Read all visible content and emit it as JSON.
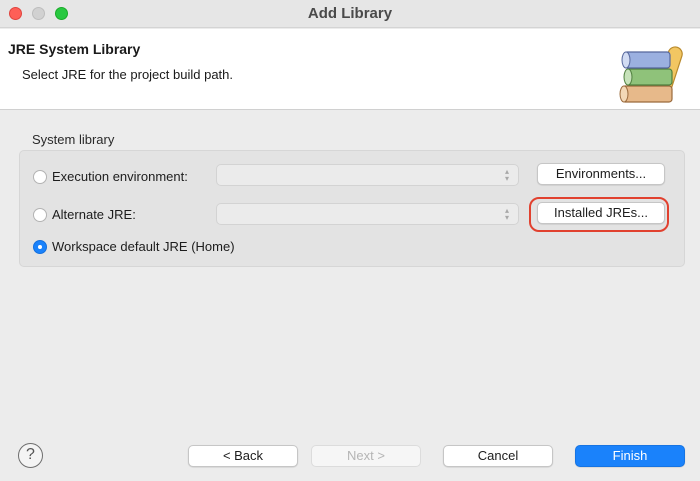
{
  "window": {
    "title": "Add Library"
  },
  "banner": {
    "title": "JRE System Library",
    "description": "Select JRE for the project build path.",
    "icon": "library-books-icon"
  },
  "group": {
    "label": "System library",
    "options": [
      {
        "label": "Execution environment:",
        "selected": false,
        "combo_value": "",
        "button": "Environments..."
      },
      {
        "label": "Alternate JRE:",
        "selected": false,
        "combo_value": "",
        "button": "Installed JREs..."
      },
      {
        "label": "Workspace default JRE (Home)",
        "selected": true
      }
    ]
  },
  "footer": {
    "help_symbol": "?",
    "back_label": "< Back",
    "next_label": "Next >",
    "cancel_label": "Cancel",
    "finish_label": "Finish"
  },
  "colors": {
    "accent": "#1a82fb",
    "highlight": "#e1412f"
  }
}
